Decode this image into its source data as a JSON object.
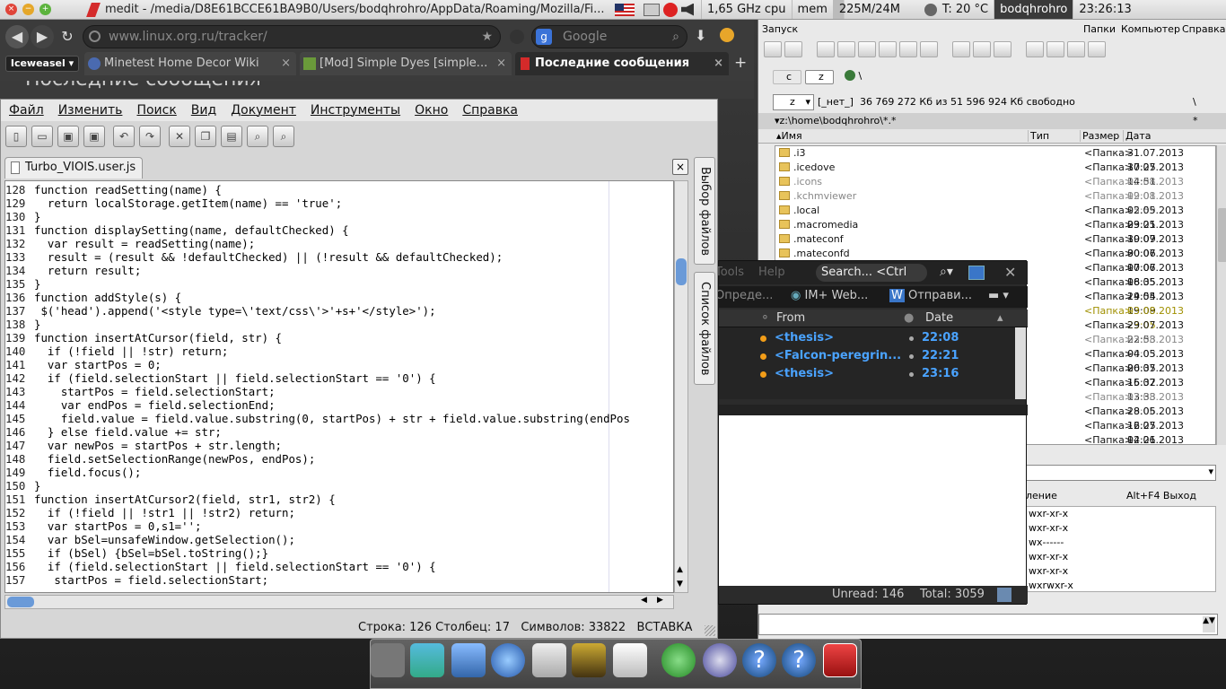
{
  "topbar": {
    "window_title": "medit - /media/D8E61BCCE61BA9B0/Users/bodqhrohro/AppData/Roaming/Mozilla/Fi...",
    "cpu": "1,65 GHz cpu",
    "mem_label": "mem",
    "mem_value": "225M/24M",
    "temp": "T: 20 °C",
    "user": "bodqhrohro",
    "clock": "23:26:13",
    "close_glyph": "×",
    "min_glyph": "−",
    "max_glyph": "+"
  },
  "browser": {
    "url": "www.linux.org.ru/tracker/",
    "search_placeholder": "Google",
    "app_label": "Iceweasel",
    "tabs": [
      {
        "label": "Minetest Home Decor Wiki",
        "close": "×"
      },
      {
        "label": "[Mod] Simple Dyes [simple...",
        "close": "×"
      },
      {
        "label": "Последние сообщения",
        "close": "×"
      }
    ],
    "new_tab": "+",
    "page_heading_fragment": "Последние сообщения"
  },
  "medit": {
    "menu": [
      "Файл",
      "Изменить",
      "Поиск",
      "Вид",
      "Документ",
      "Инструменты",
      "Окно",
      "Справка"
    ],
    "toolbar_glyphs": [
      "▯",
      "▭",
      "▣",
      "▣",
      "↶",
      "↷",
      "✕",
      "❐",
      "▤",
      "⌕",
      "⌕"
    ],
    "doc_tab": "Turbo_VIOIS.user.js",
    "doc_close": "×",
    "side_tabs": [
      "Выбор файлов",
      "Список файлов"
    ],
    "code_lines": [
      {
        "n": "128",
        "t": "function readSetting(name) {"
      },
      {
        "n": "129",
        "t": "  return localStorage.getItem(name) == 'true';"
      },
      {
        "n": "130",
        "t": "}"
      },
      {
        "n": "131",
        "t": "function displaySetting(name, defaultChecked) {"
      },
      {
        "n": "132",
        "t": "  var result = readSetting(name);"
      },
      {
        "n": "133",
        "t": "  result = (result && !defaultChecked) || (!result && defaultChecked);"
      },
      {
        "n": "134",
        "t": "  return result;"
      },
      {
        "n": "135",
        "t": "}"
      },
      {
        "n": "136",
        "t": "function addStyle(s) {"
      },
      {
        "n": "137",
        "t": " $('head').append('<style type=\\'text/css\\'>'+s+'</style>');"
      },
      {
        "n": "138",
        "t": "}"
      },
      {
        "n": "139",
        "t": "function insertAtCursor(field, str) {"
      },
      {
        "n": "140",
        "t": "  if (!field || !str) return;"
      },
      {
        "n": "141",
        "t": "  var startPos = 0;"
      },
      {
        "n": "142",
        "t": "  if (field.selectionStart || field.selectionStart == '0') {"
      },
      {
        "n": "143",
        "t": "    startPos = field.selectionStart;"
      },
      {
        "n": "144",
        "t": "    var endPos = field.selectionEnd;"
      },
      {
        "n": "145",
        "t": "    field.value = field.value.substring(0, startPos) + str + field.value.substring(endPos"
      },
      {
        "n": "146",
        "t": "  } else field.value += str;"
      },
      {
        "n": "147",
        "t": "  var newPos = startPos + str.length;"
      },
      {
        "n": "148",
        "t": "  field.setSelectionRange(newPos, endPos);"
      },
      {
        "n": "149",
        "t": "  field.focus();"
      },
      {
        "n": "150",
        "t": "}"
      },
      {
        "n": "151",
        "t": "function insertAtCursor2(field, str1, str2) {"
      },
      {
        "n": "152",
        "t": "  if (!field || !str1 || !str2) return;"
      },
      {
        "n": "153",
        "t": "  var startPos = 0,s1='';"
      },
      {
        "n": "154",
        "t": "  var bSel=unsafeWindow.getSelection();"
      },
      {
        "n": "155",
        "t": "  if (bSel) {bSel=bSel.toString();}"
      },
      {
        "n": "156",
        "t": "  if (field.selectionStart || field.selectionStart == '0') {"
      },
      {
        "n": "157",
        "t": "   startPos = field.selectionStart;"
      }
    ],
    "status": "Строка: 126 Столбец: 17   Символов: 33822   ВСТАВКА"
  },
  "filemanager": {
    "launch": "Запуск",
    "menu": [
      "Папки",
      "Компьютер",
      "Справка"
    ],
    "drive_c": "c",
    "drive_z": "z",
    "root": "\\",
    "drive_select": "z",
    "drive_info": "[_нет_]  36 769 272 Кб из 51 596 924 Кб свободно",
    "path": "▾z:\\home\\bodqhrohro\\*.*",
    "star": "*",
    "cols": [
      "▴Имя",
      "Тип",
      "Размер",
      "Дата"
    ],
    "files": [
      {
        "name": ".i3",
        "size": "<Папка>",
        "date": "31.07.2013 17:25"
      },
      {
        "name": ".icedove",
        "size": "<Папка>",
        "date": "30.07.2013 14:51"
      },
      {
        "name": ".icons",
        "size": "<Папка>",
        "date": "02.08.2013 19:01"
      },
      {
        "name": ".kchmviewer",
        "size": "<Папка>",
        "date": "02.08.2013 15:59"
      },
      {
        "name": ".local",
        "size": "<Папка>",
        "date": "02.05.2013 03:21"
      },
      {
        "name": ".macromedia",
        "size": "<Папка>",
        "date": "29.05.2013 19:09"
      },
      {
        "name": ".mateconf",
        "size": "<Папка>",
        "date": "30.07.2013 00:06"
      },
      {
        "name": ".mateconfd",
        "size": "<Папка>",
        "date": "30.07.2013 00:07"
      },
      {
        "name": "",
        "size": "<Папка>",
        "date": "17.06.2013 16:35"
      },
      {
        "name": "",
        "size": "<Папка>",
        "date": "08.05.2013 14:54"
      },
      {
        "name": "",
        "size": "<Папка>",
        "date": "29.05.2013 19:09"
      },
      {
        "name": "",
        "size": "<Папка>",
        "date": "03.08.2013 23:05"
      },
      {
        "name": "",
        "size": "<Папка>",
        "date": "29.07.2013 22:53"
      },
      {
        "name": "",
        "size": "<Папка>",
        "date": "03.08.2013 00:03"
      },
      {
        "name": "",
        "size": "<Папка>",
        "date": "04.05.2013 20:35"
      },
      {
        "name": "",
        "size": "<Папка>",
        "date": "06.07.2013 16:32"
      },
      {
        "name": "",
        "size": "<Папка>",
        "date": "15.07.2013 13:33"
      },
      {
        "name": "",
        "size": "<Папка>",
        "date": "02.08.2013 19:06"
      },
      {
        "name": "",
        "size": "<Папка>",
        "date": "28.05.2013 16:25"
      },
      {
        "name": "",
        "size": "<Папка>",
        "date": "12.07.2013 02:21"
      },
      {
        "name": "",
        "size": "<Папка>",
        "date": "14.06.2013 20:44"
      }
    ],
    "bottom_label": "ление",
    "exit_hint": "Alt+F4 Выход",
    "perms": [
      "wxr-xr-x",
      "wxr-xr-x",
      "wx------",
      "wxr-xr-x",
      "wxr-xr-x",
      "wxrwxr-x"
    ]
  },
  "chat": {
    "menu": [
      "Tools",
      "Help"
    ],
    "search_placeholder": "Search... <Ctrl",
    "tabs": [
      "Опреде...",
      "IM+ Web...",
      "Отправи..."
    ],
    "col_from": "From",
    "col_date": "Date",
    "rows": [
      {
        "from": "<thesis>",
        "date": "22:08"
      },
      {
        "from": "<Falcon-peregrin...",
        "date": "22:21"
      },
      {
        "from": "<thesis>",
        "date": "23:16"
      }
    ],
    "unread": "Unread: 146",
    "total": "Total: 3059"
  },
  "colors": {
    "accent_blue": "#4aa3ff",
    "status_orange": "#f29d18"
  }
}
